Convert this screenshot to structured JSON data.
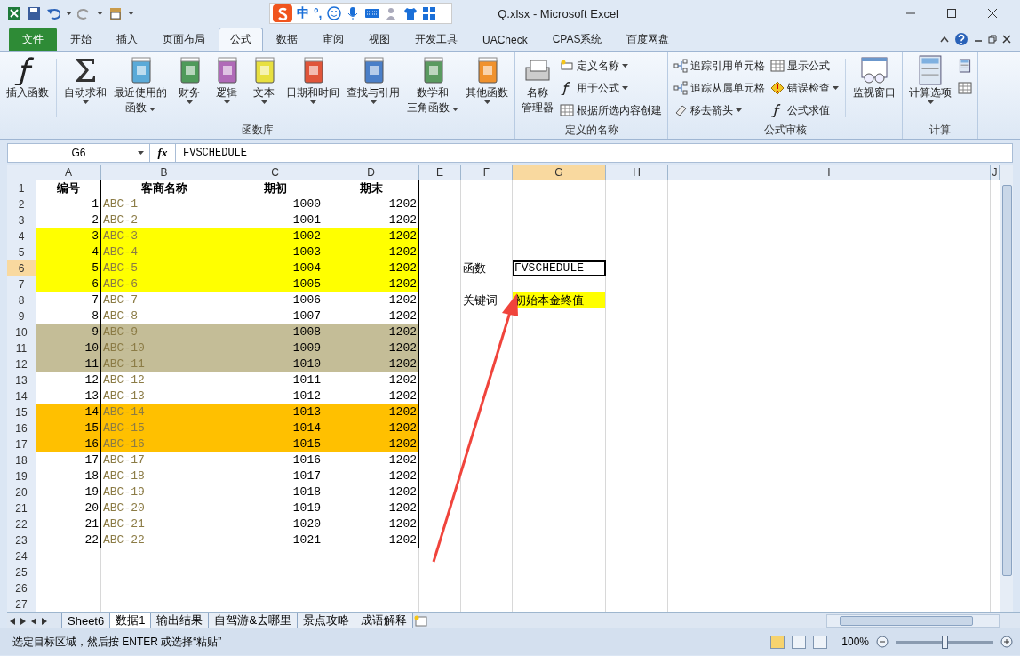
{
  "window": {
    "title": "Q.xlsx  -  Microsoft Excel"
  },
  "ime_bar": {
    "items": [
      "中",
      "°,"
    ]
  },
  "tabs": [
    {
      "label": "文件",
      "kind": "file",
      "selected": false
    },
    {
      "label": "开始",
      "kind": "tab",
      "selected": false
    },
    {
      "label": "插入",
      "kind": "tab",
      "selected": false
    },
    {
      "label": "页面布局",
      "kind": "tab",
      "selected": false
    },
    {
      "label": "公式",
      "kind": "tab",
      "selected": true
    },
    {
      "label": "数据",
      "kind": "tab",
      "selected": false
    },
    {
      "label": "审阅",
      "kind": "tab",
      "selected": false
    },
    {
      "label": "视图",
      "kind": "tab",
      "selected": false
    },
    {
      "label": "开发工具",
      "kind": "tab",
      "selected": false
    },
    {
      "label": "UACheck",
      "kind": "tab",
      "selected": false
    },
    {
      "label": "CPAS系统",
      "kind": "tab",
      "selected": false
    },
    {
      "label": "百度网盘",
      "kind": "tab",
      "selected": false
    }
  ],
  "ribbon": {
    "groups": [
      {
        "title": "函数库",
        "items": [
          {
            "kind": "large",
            "label": [
              "插入函数"
            ],
            "dropdown": false
          },
          {
            "kind": "large",
            "label": [
              "自动求和"
            ],
            "dropdown": true
          },
          {
            "kind": "large",
            "label": [
              "最近使用的",
              "函数"
            ],
            "dropdown": true
          },
          {
            "kind": "large",
            "label": [
              "财务"
            ],
            "dropdown": true
          },
          {
            "kind": "large",
            "label": [
              "逻辑"
            ],
            "dropdown": true
          },
          {
            "kind": "large",
            "label": [
              "文本"
            ],
            "dropdown": true
          },
          {
            "kind": "large",
            "label": [
              "日期和时间"
            ],
            "dropdown": true
          },
          {
            "kind": "large",
            "label": [
              "查找与引用"
            ],
            "dropdown": true
          },
          {
            "kind": "large",
            "label": [
              "数学和",
              "三角函数"
            ],
            "dropdown": true
          },
          {
            "kind": "large",
            "label": [
              "其他函数"
            ],
            "dropdown": true
          }
        ]
      },
      {
        "title": "定义的名称",
        "items": [
          {
            "kind": "large",
            "label": [
              "名称",
              "管理器"
            ],
            "dropdown": false
          },
          {
            "kind": "small",
            "label": [
              "定义名称"
            ],
            "dropdown": true
          },
          {
            "kind": "small",
            "label": [
              "用于公式"
            ],
            "dropdown": true
          },
          {
            "kind": "small",
            "label": [
              "根据所选内容创建"
            ],
            "dropdown": false
          }
        ]
      },
      {
        "title": "公式审核",
        "items": [
          {
            "kind": "small",
            "label": [
              "追踪引用单元格"
            ],
            "dropdown": false
          },
          {
            "kind": "small",
            "label": [
              "追踪从属单元格"
            ],
            "dropdown": false
          },
          {
            "kind": "small",
            "label": [
              "移去箭头"
            ],
            "dropdown": true
          },
          {
            "kind": "small",
            "label": [
              "显示公式"
            ],
            "dropdown": false
          },
          {
            "kind": "small",
            "label": [
              "错误检查"
            ],
            "dropdown": true
          },
          {
            "kind": "small",
            "label": [
              "公式求值"
            ],
            "dropdown": false
          },
          {
            "kind": "large",
            "label": [
              "监视窗口"
            ],
            "dropdown": false
          }
        ]
      },
      {
        "title": "计算",
        "items": [
          {
            "kind": "large",
            "label": [
              "计算选项"
            ],
            "dropdown": true
          },
          {
            "kind": "small",
            "dropdown": false
          },
          {
            "kind": "small",
            "dropdown": false
          }
        ]
      }
    ]
  },
  "formula_bar": {
    "name_box": "G6",
    "fx": "fx",
    "formula": "FVSCHEDULE"
  },
  "sheet": {
    "columns": [
      {
        "label": "A",
        "selected": false
      },
      {
        "label": "B",
        "selected": false
      },
      {
        "label": "C",
        "selected": false
      },
      {
        "label": "D",
        "selected": false
      },
      {
        "label": "E",
        "selected": false
      },
      {
        "label": "F",
        "selected": false
      },
      {
        "label": "G",
        "selected": true
      },
      {
        "label": "H",
        "selected": false
      },
      {
        "label": "I",
        "selected": false
      },
      {
        "label": "J",
        "selected": false
      }
    ],
    "row_headers": [
      {
        "label": "1",
        "selected": false
      },
      {
        "label": "2",
        "selected": false
      },
      {
        "label": "3",
        "selected": false
      },
      {
        "label": "4",
        "selected": false
      },
      {
        "label": "5",
        "selected": false
      },
      {
        "label": "6",
        "selected": true
      },
      {
        "label": "7",
        "selected": false
      },
      {
        "label": "8",
        "selected": false
      },
      {
        "label": "9",
        "selected": false
      },
      {
        "label": "10",
        "selected": false
      },
      {
        "label": "11",
        "selected": false
      },
      {
        "label": "12",
        "selected": false
      },
      {
        "label": "13",
        "selected": false
      },
      {
        "label": "14",
        "selected": false
      },
      {
        "label": "15",
        "selected": false
      },
      {
        "label": "16",
        "selected": false
      },
      {
        "label": "17",
        "selected": false
      },
      {
        "label": "18",
        "selected": false
      },
      {
        "label": "19",
        "selected": false
      },
      {
        "label": "20",
        "selected": false
      },
      {
        "label": "21",
        "selected": false
      },
      {
        "label": "22",
        "selected": false
      },
      {
        "label": "23",
        "selected": false
      },
      {
        "label": "24",
        "selected": false
      },
      {
        "label": "25",
        "selected": false
      },
      {
        "label": "26",
        "selected": false
      },
      {
        "label": "27",
        "selected": false
      }
    ],
    "header": [
      "编号",
      "客商名称",
      "期初",
      "期末"
    ],
    "rows": [
      {
        "cells": [
          "1",
          "ABC-1",
          "1000",
          "1202"
        ]
      },
      {
        "cells": [
          "2",
          "ABC-2",
          "1001",
          "1202"
        ]
      },
      {
        "cells": [
          "3",
          "ABC-3",
          "1002",
          "1202"
        ],
        "color": "#ffff00"
      },
      {
        "cells": [
          "4",
          "ABC-4",
          "1003",
          "1202"
        ],
        "color": "#ffff00"
      },
      {
        "cells": [
          "5",
          "ABC-5",
          "1004",
          "1202"
        ],
        "color": "#ffff00"
      },
      {
        "cells": [
          "6",
          "ABC-6",
          "1005",
          "1202"
        ],
        "color": "#ffff00"
      },
      {
        "cells": [
          "7",
          "ABC-7",
          "1006",
          "1202"
        ]
      },
      {
        "cells": [
          "8",
          "ABC-8",
          "1007",
          "1202"
        ]
      },
      {
        "cells": [
          "9",
          "ABC-9",
          "1008",
          "1202"
        ],
        "color": "#c4bd97"
      },
      {
        "cells": [
          "10",
          "ABC-10",
          "1009",
          "1202"
        ],
        "color": "#c4bd97"
      },
      {
        "cells": [
          "11",
          "ABC-11",
          "1010",
          "1202"
        ],
        "color": "#c4bd97"
      },
      {
        "cells": [
          "12",
          "ABC-12",
          "1011",
          "1202"
        ]
      },
      {
        "cells": [
          "13",
          "ABC-13",
          "1012",
          "1202"
        ]
      },
      {
        "cells": [
          "14",
          "ABC-14",
          "1013",
          "1202"
        ],
        "color": "#ffc000"
      },
      {
        "cells": [
          "15",
          "ABC-15",
          "1014",
          "1202"
        ],
        "color": "#ffc000"
      },
      {
        "cells": [
          "16",
          "ABC-16",
          "1015",
          "1202"
        ],
        "color": "#ffc000"
      },
      {
        "cells": [
          "17",
          "ABC-17",
          "1016",
          "1202"
        ]
      },
      {
        "cells": [
          "18",
          "ABC-18",
          "1017",
          "1202"
        ]
      },
      {
        "cells": [
          "19",
          "ABC-19",
          "1018",
          "1202"
        ]
      },
      {
        "cells": [
          "20",
          "ABC-20",
          "1019",
          "1202"
        ]
      },
      {
        "cells": [
          "21",
          "ABC-21",
          "1020",
          "1202"
        ]
      },
      {
        "cells": [
          "22",
          "ABC-22",
          "1021",
          "1202"
        ]
      }
    ],
    "notes": [
      {
        "label": "函数",
        "value": "FVSCHEDULE",
        "selected": true
      },
      {
        "label": "关键词",
        "value": "初始本金终值",
        "selected": false,
        "color": "#ffff00"
      }
    ]
  },
  "sheet_tabs": [
    {
      "label": "Sheet6",
      "selected": false
    },
    {
      "label": "数据1",
      "selected": true
    },
    {
      "label": "输出结果",
      "selected": false
    },
    {
      "label": "自驾游&去哪里",
      "selected": false
    },
    {
      "label": "景点攻略",
      "selected": false
    },
    {
      "label": "成语解释",
      "selected": false
    }
  ],
  "status_bar": {
    "message": "选定目标区域，然后按 ENTER 或选择“粘贴”",
    "zoom": "100%",
    "zoom_level": {
      "level": 0.5
    }
  }
}
